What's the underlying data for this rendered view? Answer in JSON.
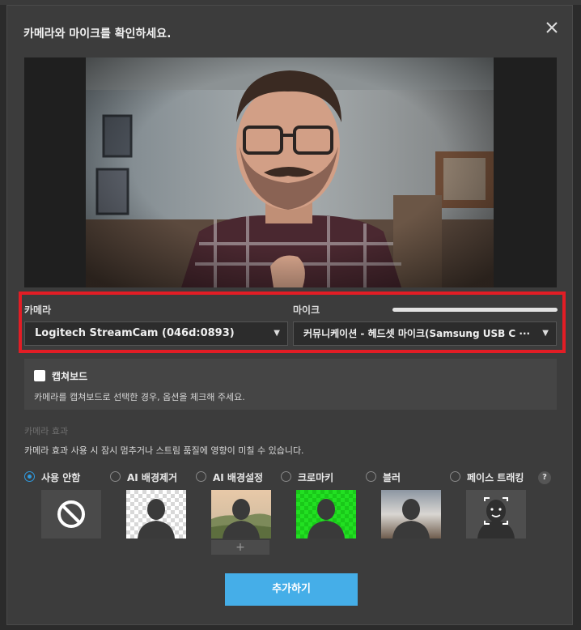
{
  "dialog": {
    "title": "카메라와 마이크를 확인하세요."
  },
  "devices": {
    "camera_label": "카메라",
    "camera_value": "Logitech StreamCam (046d:0893)",
    "mic_label": "마이크",
    "mic_value": "커뮤니케이션 - 헤드셋 마이크(Samsung USB C ···",
    "mic_level": 1.0
  },
  "capture_board": {
    "label": "캡쳐보드",
    "description": "카메라를 캡쳐보드로 선택한 경우, 옵션을 체크해 주세요.",
    "checked": false
  },
  "effects": {
    "section_title": "카메라 효과",
    "notice": "카메라 효과 사용 시 잠시 멈추거나 스트림 품질에 영향이 미칠 수 있습니다.",
    "help": "?",
    "items": [
      {
        "label": "사용 안함",
        "selected": true,
        "icon": "prohibited-icon"
      },
      {
        "label": "AI 배경제거",
        "selected": false,
        "icon": "person-transparent-bg"
      },
      {
        "label": "AI 배경설정",
        "selected": false,
        "icon": "person-landscape-bg",
        "add": "+"
      },
      {
        "label": "크로마키",
        "selected": false,
        "icon": "person-green-bg"
      },
      {
        "label": "블러",
        "selected": false,
        "icon": "person-blur-bg"
      },
      {
        "label": "페이스 트래킹",
        "selected": false,
        "icon": "face-tracking-icon"
      }
    ]
  },
  "footer": {
    "add_button": "추가하기"
  },
  "colors": {
    "accent": "#45aee8",
    "highlight_border": "#e21d25",
    "chroma_green": "#1ed61e"
  }
}
